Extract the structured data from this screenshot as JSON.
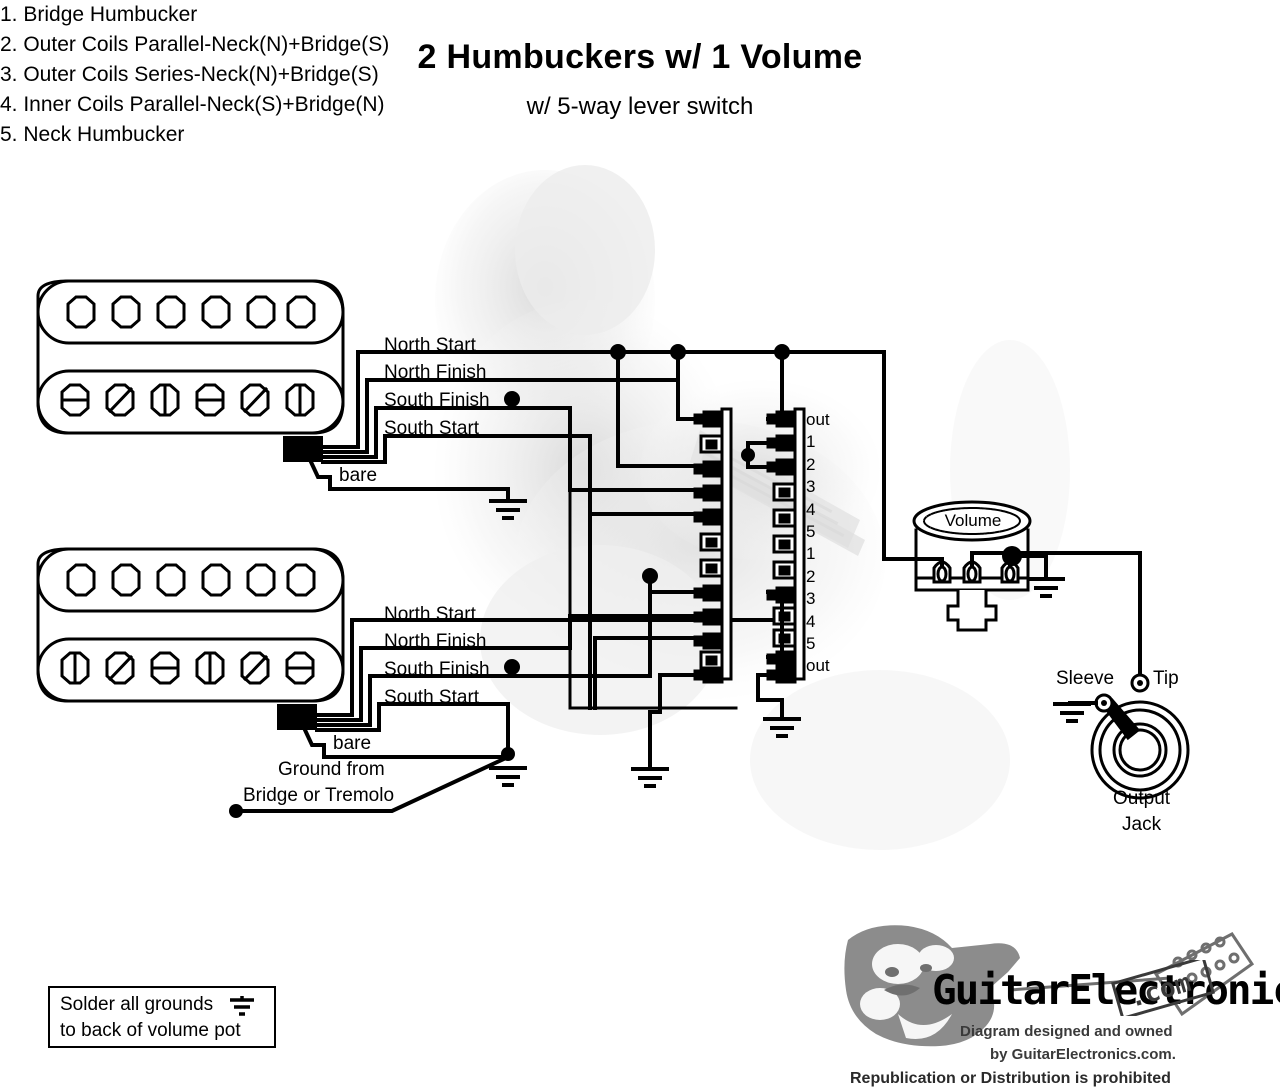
{
  "doc": {
    "title": "2 Humbuckers w/ 1 Volume",
    "subtitle": "w/ 5-way lever switch",
    "ink": "#000000",
    "background": "#ffffff",
    "watermark_color": "#e8e8e8"
  },
  "legend": {
    "items": [
      "1. Bridge Humbucker",
      "2. Outer Coils Parallel-Neck(N)+Bridge(S)",
      "3. Outer Coils Series-Neck(N)+Bridge(S)",
      "4. Inner Coils Parallel-Neck(S)+Bridge(N)",
      "5. Neck Humbucker"
    ]
  },
  "pickups": {
    "bridge": {
      "name": "Bridge Humbucker",
      "wires": [
        "North Start",
        "North Finish",
        "South Finish",
        "South Start"
      ],
      "shield_label": "bare",
      "slug_poles": 6,
      "screw_poles": 6,
      "screw_slots": [
        "h",
        "d",
        "v",
        "h",
        "d",
        "v"
      ]
    },
    "neck": {
      "name": "Neck Humbucker",
      "wires": [
        "North Start",
        "North Finish",
        "South Finish",
        "South Start"
      ],
      "shield_label": "bare",
      "slug_poles": 6,
      "screw_poles": 6,
      "screw_slots": [
        "v",
        "d",
        "h",
        "v",
        "d",
        "h"
      ]
    }
  },
  "ground_source": {
    "line1": "Ground from",
    "line2": "Bridge or Tremolo"
  },
  "switch": {
    "name": "5-way lever switch",
    "terminals_left": [
      "out",
      "1",
      "2",
      "3",
      "4",
      "5",
      "1",
      "2",
      "3",
      "4",
      "5",
      "out"
    ],
    "terminals_right": [
      "out",
      "1",
      "2",
      "3",
      "4",
      "5",
      "1",
      "2",
      "3",
      "4",
      "5",
      "out"
    ]
  },
  "volume_pot": {
    "label": "Volume",
    "lugs": 3
  },
  "output_jack": {
    "label_line1": "Output",
    "label_line2": "Jack",
    "tip_label": "Tip",
    "sleeve_label": "Sleeve"
  },
  "note": {
    "line1": "Solder all grounds",
    "line2": "to back of volume pot",
    "icon": "ground-symbol"
  },
  "footer": {
    "brand": "GuitarElectronics",
    "brand_tld": ".com",
    "credit_line1": "Diagram designed and owned",
    "credit_line2": "by GuitarElectronics.com.",
    "legal": "Republication or Distribution is prohibited"
  }
}
